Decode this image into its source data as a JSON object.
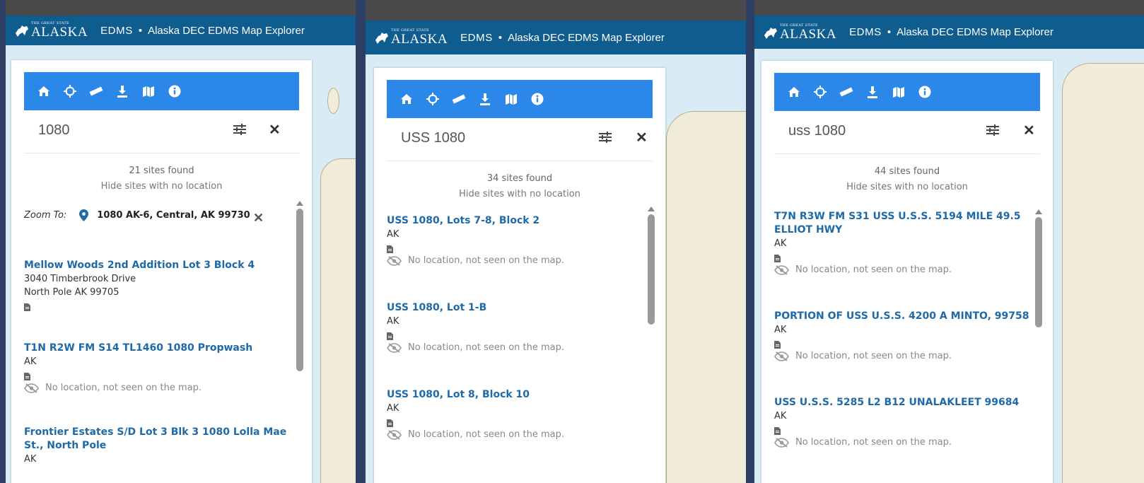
{
  "header": {
    "logo_small": "THE GREAT STATE",
    "logo_big": "ALASKA",
    "app_name": "EDMS",
    "separator": "•",
    "app_title": "Alaska DEC EDMS Map Explorer"
  },
  "colors": {
    "header": "#0f5c8f",
    "toolbar": "#2b88e8",
    "link": "#1e6aa8"
  },
  "toolbar_icons": [
    "home-icon",
    "crosshair-icon",
    "ruler-icon",
    "download-icon",
    "map-icon",
    "info-icon"
  ],
  "screens": [
    {
      "search_value": "1080",
      "count": "21 sites found",
      "hide_link": "Hide sites with no location",
      "zoom": {
        "label": "Zoom To:",
        "address": "1080 AK-6, Central, AK 99730"
      },
      "results": [
        {
          "title": "Mellow Woods 2nd Addition Lot 3 Block 4",
          "lines": [
            "3040 Timberbrook Drive",
            "North Pole AK 99705"
          ]
        },
        {
          "title": "T1N R2W FM S14 TL1460 1080 Propwash",
          "lines": [
            "AK"
          ],
          "noloc": "No location, not seen on the map."
        },
        {
          "title": "Frontier Estates S/D Lot 3 Blk 3 1080 Lolla Mae St., North Pole",
          "lines": [
            "AK"
          ]
        }
      ]
    },
    {
      "search_value": "USS 1080",
      "count": "34 sites found",
      "hide_link": "Hide sites with no location",
      "results": [
        {
          "title": "USS 1080, Lots 7-8, Block 2",
          "lines": [
            "AK"
          ],
          "noloc": "No location, not seen on the map."
        },
        {
          "title": "USS 1080, Lot 1-B",
          "lines": [
            "AK"
          ],
          "noloc": "No location, not seen on the map."
        },
        {
          "title": "USS 1080, Lot 8, Block 10",
          "lines": [
            "AK"
          ],
          "noloc": "No location, not seen on the map."
        }
      ]
    },
    {
      "search_value": "uss 1080",
      "count": "44 sites found",
      "hide_link": "Hide sites with no location",
      "results": [
        {
          "title": "T7N R3W FM S31 USS U.S.S. 5194 MILE 49.5 ELLIOT HWY",
          "lines": [
            "AK"
          ],
          "noloc": "No location, not seen on the map."
        },
        {
          "title": "PORTION OF USS U.S.S. 4200 A MINTO, 99758",
          "lines": [
            "AK"
          ],
          "noloc": "No location, not seen on the map."
        },
        {
          "title": "USS U.S.S. 5285 L2 B12 UNALAKLEET 99684",
          "lines": [
            "AK"
          ],
          "noloc": "No location, not seen on the map."
        }
      ]
    }
  ]
}
